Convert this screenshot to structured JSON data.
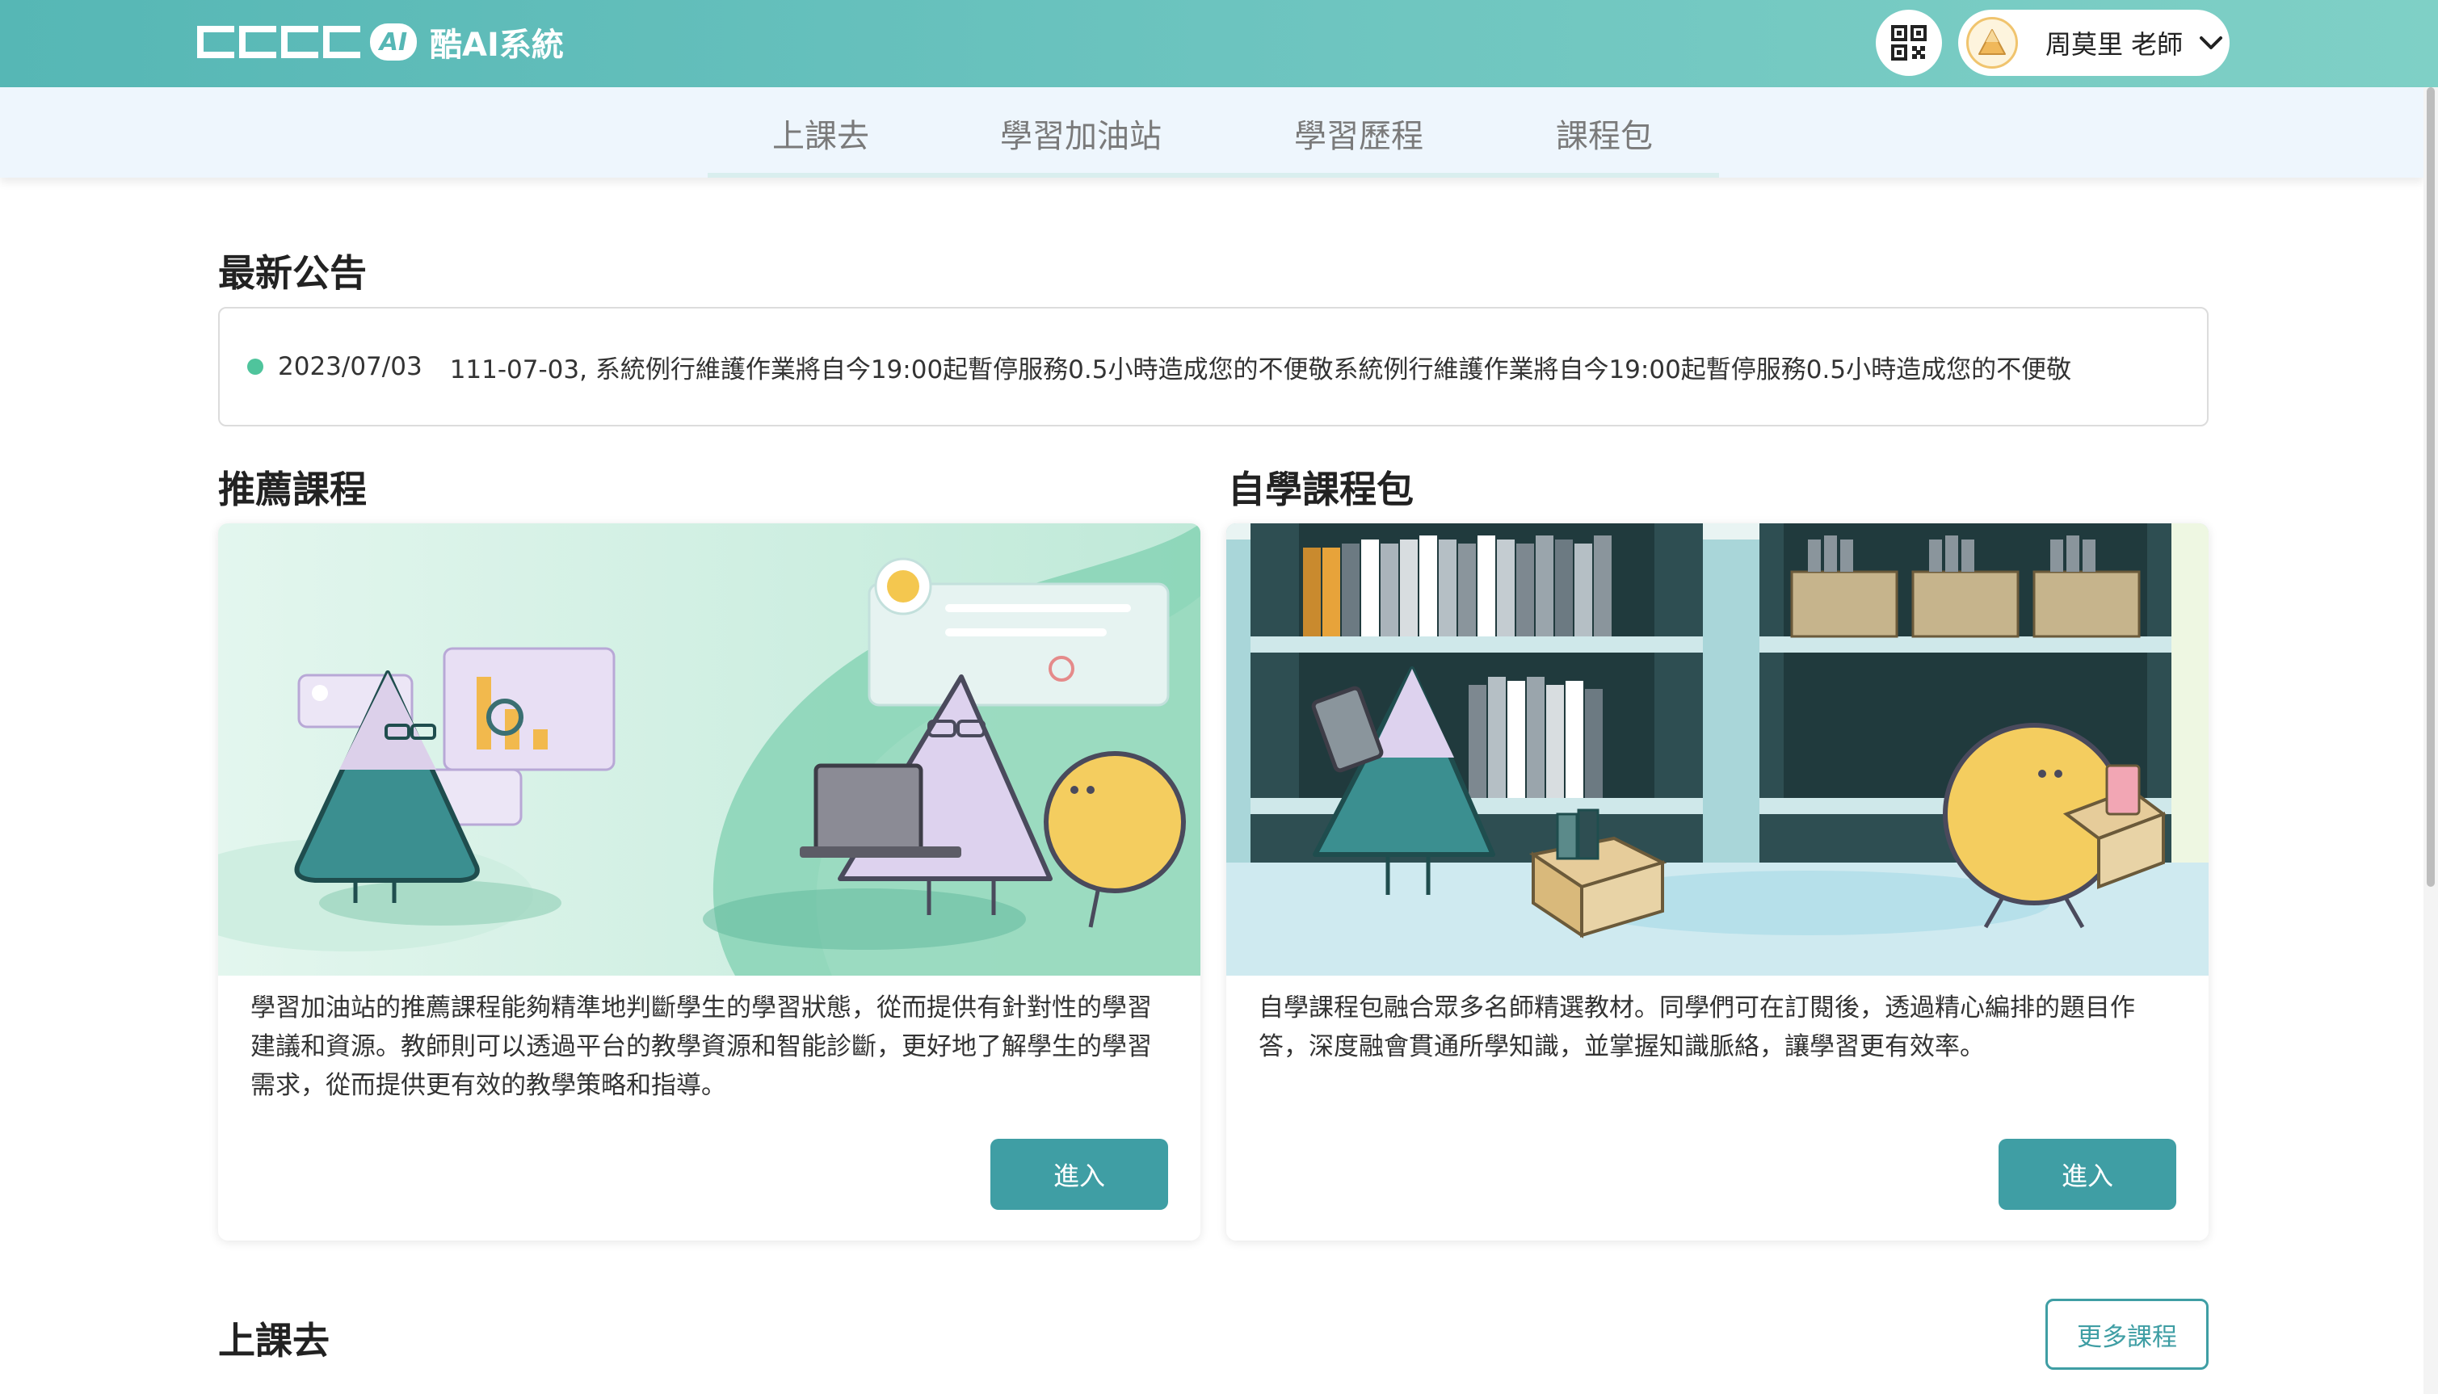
{
  "header": {
    "logo_text": "酷AI系統",
    "logo_badge": "AI",
    "qr_icon": "qr-code-icon",
    "user_name": "周莫里 老師",
    "avatar_icon": "triangle-avatar-icon",
    "dropdown_icon": "chevron-down-icon"
  },
  "nav": {
    "items": [
      {
        "label": "上課去"
      },
      {
        "label": "學習加油站"
      },
      {
        "label": "學習歷程"
      },
      {
        "label": "課程包"
      }
    ]
  },
  "announcements": {
    "title": "最新公告",
    "items": [
      {
        "date": "2023/07/03",
        "text": "111-07-03, 系統例行維護作業將自今19:00起暫停服務0.5小時造成您的不便敬系統例行維護作業將自今19:00起暫停服務0.5小時造成您的不便敬"
      }
    ]
  },
  "recommended": {
    "title": "推薦課程",
    "description": "學習加油站的推薦課程能夠精準地判斷學生的學習狀態，從而提供有針對性的學習建議和資源。教師則可以透過平台的教學資源和智能診斷，更好地了解學生的學習需求，從而提供更有效的教學策略和指導。",
    "button": "進入"
  },
  "selfstudy": {
    "title": "自學課程包",
    "description": "自學課程包融合眾多名師精選教材。同學們可在訂閱後，透過精心編排的題目作答，深度融會貫通所學知識，並掌握知識脈絡，讓學習更有效率。",
    "button": "進入"
  },
  "classes": {
    "title": "上課去",
    "more_button": "更多課程"
  },
  "colors": {
    "header_start": "#56b7b5",
    "header_end": "#7fd0c6",
    "accent": "#3f9ea4",
    "status_dot": "#4fc49c"
  }
}
